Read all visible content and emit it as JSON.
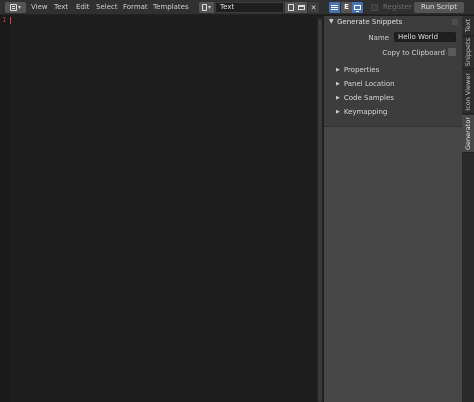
{
  "header": {
    "menus": [
      "View",
      "Text",
      "Edit",
      "Select",
      "Format",
      "Templates"
    ],
    "text_block_name": "Text",
    "register_label": "Register",
    "run_script_label": "Run Script"
  },
  "editor": {
    "line_number": "1"
  },
  "sidebar": {
    "panel_title": "Generate Snippets",
    "name_label": "Name",
    "name_value": "Hello World",
    "copy_label": "Copy to Clipboard",
    "copy_checked": false,
    "subpanels": [
      "Properties",
      "Panel Location",
      "Code Samples",
      "Keymapping"
    ]
  },
  "tabs": [
    "Text",
    "Snippets",
    "Icon Viewer",
    "Generator"
  ],
  "colors": {
    "accent": "#4772b3",
    "header_bg": "#303030",
    "editor_bg": "#1d1d1d",
    "sidebar_bg": "#424242",
    "line_number": "#cc3333"
  },
  "icons": [
    "text-editor-icon",
    "text-block-icon",
    "new-text-icon",
    "open-folder-icon",
    "close-icon",
    "line-numbers-icon",
    "word-wrap-icon",
    "syntax-highlight-icon"
  ]
}
